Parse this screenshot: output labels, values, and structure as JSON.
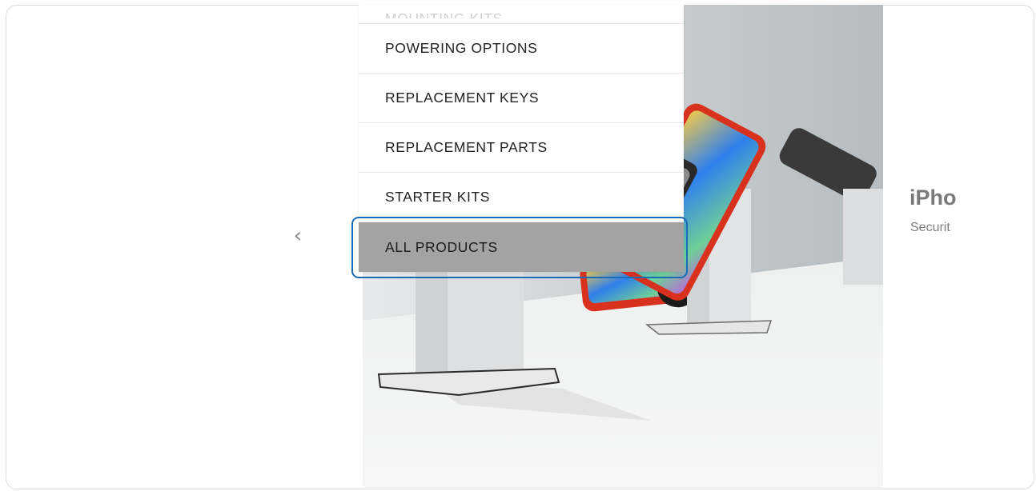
{
  "menu": {
    "items": [
      {
        "label": "MOUNTING KITS",
        "state": "partial"
      },
      {
        "label": "POWERING OPTIONS",
        "state": "normal"
      },
      {
        "label": "REPLACEMENT KEYS",
        "state": "normal"
      },
      {
        "label": "REPLACEMENT PARTS",
        "state": "normal"
      },
      {
        "label": "STARTER KITS",
        "state": "normal"
      },
      {
        "label": "ALL PRODUCTS",
        "state": "active"
      }
    ]
  },
  "carousel": {
    "prev_glyph": "‹",
    "side_title": "iPho",
    "side_subtitle": "Securit"
  },
  "colors": {
    "highlight": "#1a6bb5",
    "active_item_bg": "#a3a3a3",
    "phone_case": "#d8321e"
  }
}
